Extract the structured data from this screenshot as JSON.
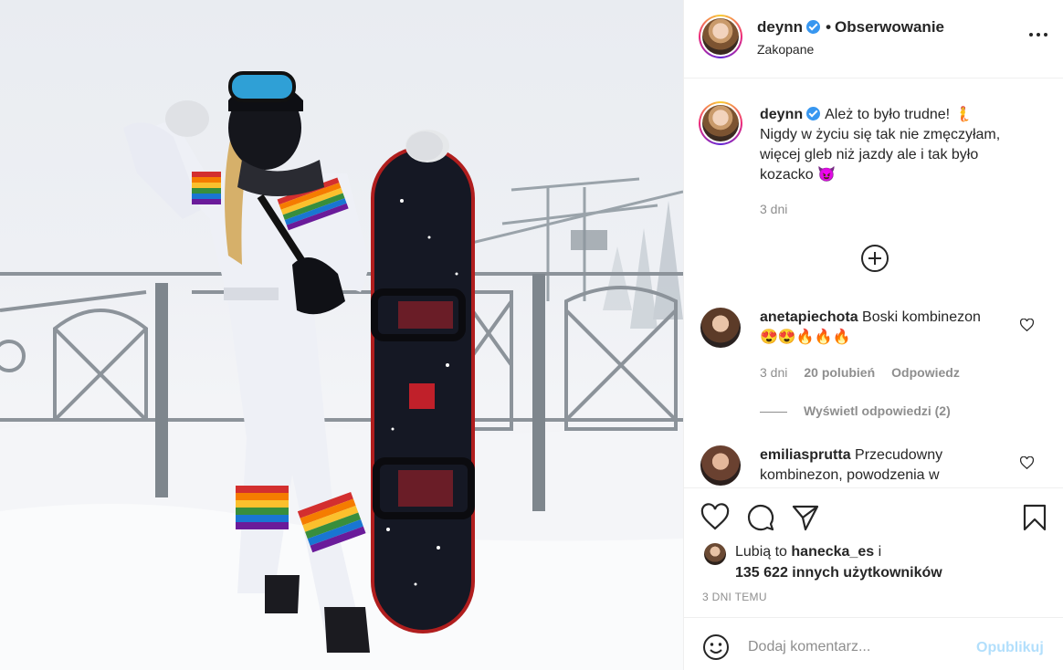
{
  "post": {
    "username": "deynn",
    "follow_label": "Obserwowanie",
    "location": "Zakopane",
    "caption_lines": [
      "Ależ to było trudne! 🧜",
      "Nigdy w życiu się tak nie zmęczyłam,",
      "więcej gleb niż jazdy ale i tak było",
      "kozacko 😈"
    ],
    "caption_age": "3 dni"
  },
  "comments": [
    {
      "username": "anetapiechota",
      "text_line1": "Boski kombinezon",
      "text_line2": "😍😍🔥🔥🔥",
      "age": "3 dni",
      "likes": "20 polubień",
      "reply": "Odpowiedz",
      "view_replies": "Wyświetl odpowiedzi (2)"
    },
    {
      "username": "emiliasprutta",
      "text_line1": "Przecudowny",
      "text_line2": "kombinezon, powodzenia w"
    }
  ],
  "likes": {
    "prefix": "Lubią to",
    "user": "hanecka_es",
    "conj": "i",
    "others": "135 622 innych użytkowników"
  },
  "timestamp": "3 DNI TEMU",
  "add_comment": {
    "placeholder": "Dodaj komentarz...",
    "publish": "Opublikuj"
  },
  "icons": {
    "heart": "heart-icon",
    "comment": "comment-icon",
    "share": "share-icon",
    "save": "bookmark-icon",
    "more": "more-options-icon",
    "emoji": "emoji-icon",
    "expand": "plus-circle-icon"
  },
  "colors": {
    "text": "#262626",
    "secondary": "#8e8e8e",
    "verified": "#3897f0",
    "publish_disabled": "#b2dffc"
  }
}
